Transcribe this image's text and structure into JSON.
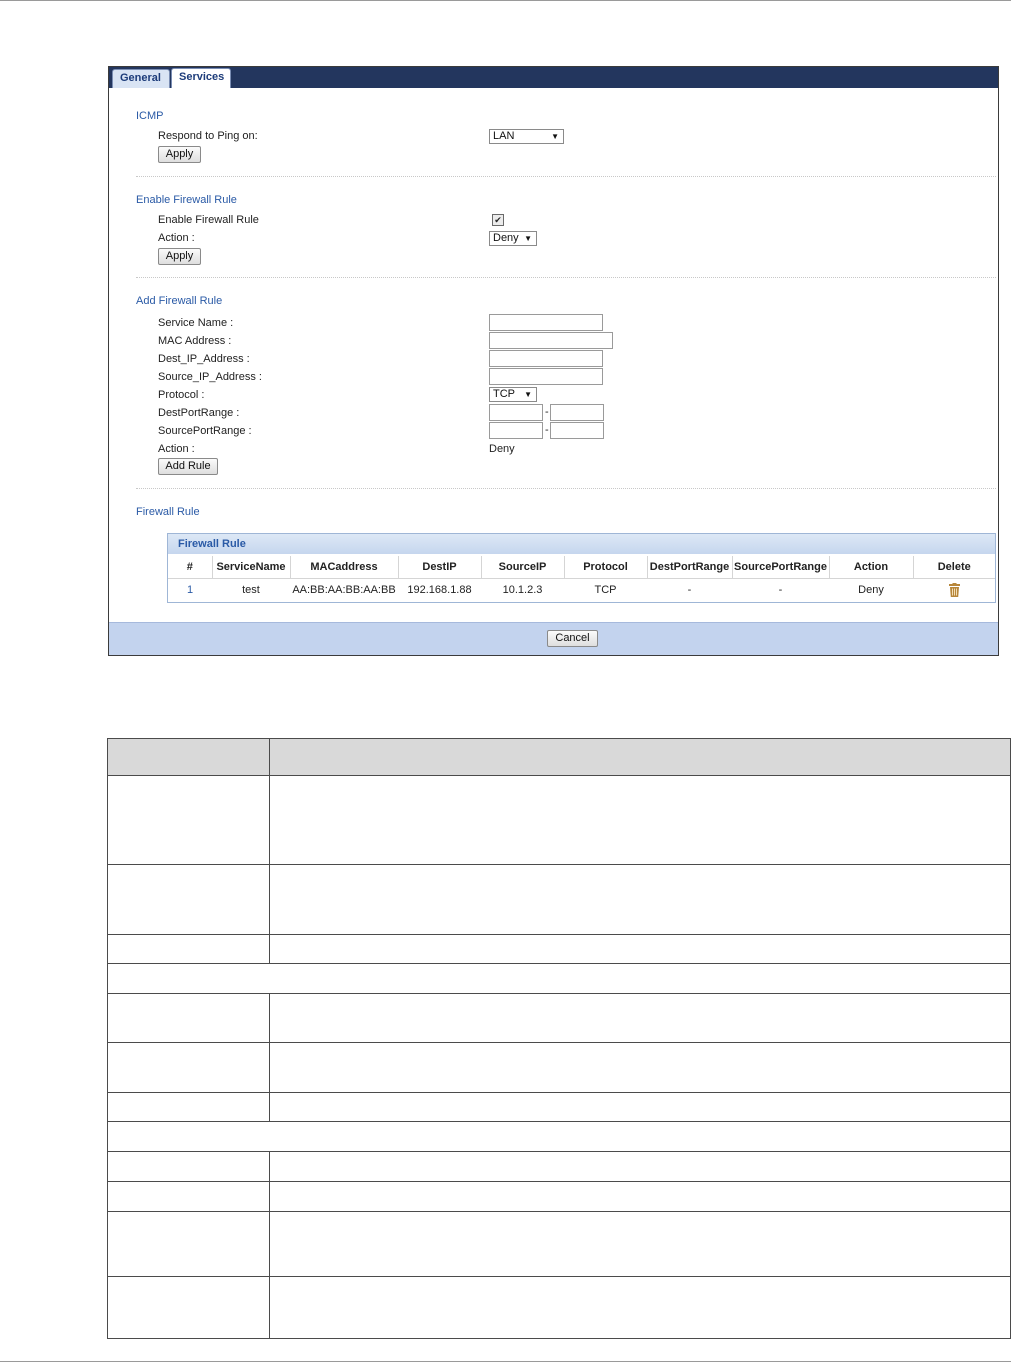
{
  "tabs": [
    {
      "label": "General"
    },
    {
      "label": "Services"
    }
  ],
  "icmp": {
    "title": "ICMP",
    "respond_label": "Respond to Ping on:",
    "respond_value": "LAN",
    "apply_label": "Apply"
  },
  "enable_rule": {
    "title": "Enable Firewall Rule",
    "enable_label": "Enable Firewall Rule",
    "enabled": true,
    "action_label": "Action :",
    "action_value": "Deny",
    "apply_label": "Apply"
  },
  "add_rule": {
    "title": "Add Firewall Rule",
    "service_name_label": "Service Name :",
    "mac_label": "MAC Address :",
    "dest_ip_label": "Dest_IP_Address :",
    "source_ip_label": "Source_IP_Address :",
    "protocol_label": "Protocol :",
    "protocol_value": "TCP",
    "dest_port_label": "DestPortRange :",
    "source_port_label": "SourcePortRange :",
    "action_label": "Action :",
    "action_value": "Deny",
    "range_separator": "-",
    "add_button": "Add Rule"
  },
  "firewall_rule": {
    "section_title": "Firewall Rule",
    "box_title": "Firewall Rule",
    "columns": [
      "#",
      "ServiceName",
      "MACaddress",
      "DestIP",
      "SourceIP",
      "Protocol",
      "DestPortRange",
      "SourcePortRange",
      "Action",
      "Delete"
    ],
    "rows": [
      {
        "num": "1",
        "service": "test",
        "mac": "AA:BB:AA:BB:AA:BB",
        "dest_ip": "192.168.1.88",
        "source_ip": "10.1.2.3",
        "protocol": "TCP",
        "dest_port": "-",
        "source_port": "-",
        "action": "Deny",
        "delete_icon": "trash-icon"
      }
    ]
  },
  "cancel_label": "Cancel",
  "colors": {
    "tab_bar": "#23365e",
    "section_title": "#2a5aa6",
    "footer_bar": "#c3d3ee",
    "trash": "#b7863a"
  }
}
